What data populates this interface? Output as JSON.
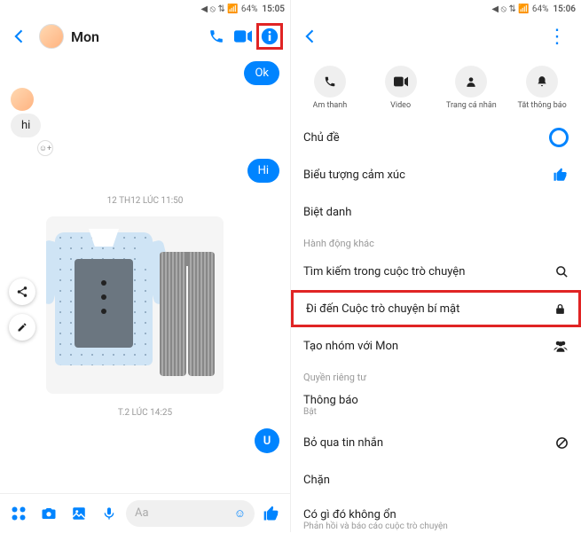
{
  "status": {
    "icons": "◀ ⦸ ⇅ 📶",
    "battery": "64%",
    "time_left": "15:05",
    "time_right": "15:06"
  },
  "contact": {
    "name": "Mon"
  },
  "chat": {
    "msg_ok": "Ok",
    "msg_hi_them": "hi",
    "msg_hi_me": "Hi",
    "ts1": "12 TH12 LÚC 11:50",
    "ts2": "T.2 LÚC 14:25",
    "u_badge": "U"
  },
  "composer": {
    "placeholder": "Aa"
  },
  "actions": [
    {
      "label": "Âm thanh"
    },
    {
      "label": "Video"
    },
    {
      "label": "Trang cá nhân"
    },
    {
      "label": "Tắt thông báo"
    }
  ],
  "opts": {
    "theme": "Chủ đề",
    "emoji": "Biểu tượng cảm xúc",
    "nick": "Biệt danh",
    "sec_other": "Hành động khác",
    "search": "Tìm kiếm trong cuộc trò chuyện",
    "secret": "Đi đến Cuộc trò chuyện bí mật",
    "group": "Tạo nhóm với Mon",
    "sec_priv": "Quyền riêng tư",
    "notif": "Thông báo",
    "notif_sub": "Bật",
    "ignore": "Bỏ qua tin nhắn",
    "block": "Chặn",
    "wrong": "Có gì đó không ổn",
    "wrong_sub": "Phản hồi và báo cáo cuộc trò chuyện"
  }
}
